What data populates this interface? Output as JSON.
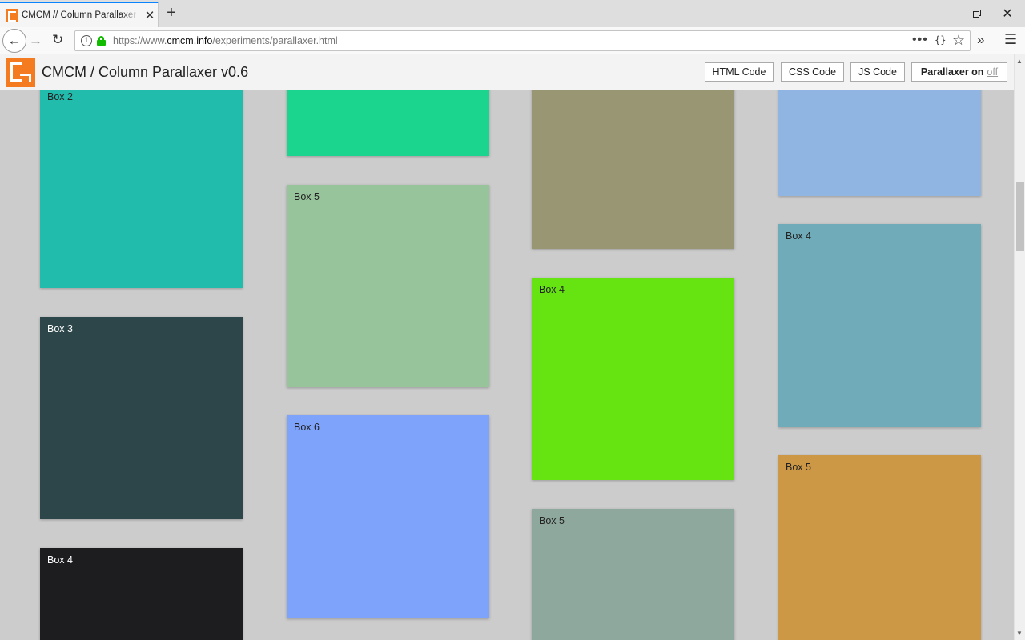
{
  "browser": {
    "tab_title": "CMCM // Column Parallaxer // CMCM",
    "url_prefix": "https://www.",
    "url_host": "cmcm.info",
    "url_path": "/experiments/parallaxer.html"
  },
  "header": {
    "title": "CMCM / Column Parallaxer v0.6",
    "buttons": {
      "html": "HTML Code",
      "css": "CSS Code",
      "js": "JS Code",
      "parallaxer": "Parallaxer on",
      "parallaxer_off": "off"
    }
  },
  "colors": {
    "accent_tab": "#0a84ff",
    "logo": "#f47b20",
    "page_bg": "#cccccc"
  },
  "columns": [
    {
      "boxes": [
        {
          "label": "Box 2",
          "color": "#22bcac",
          "text_color": "#222222"
        },
        {
          "label": "Box 3",
          "color": "#2d464a",
          "text_color": "#ffffff"
        },
        {
          "label": "Box 4",
          "color": "#1d1d20",
          "text_color": "#ffffff"
        }
      ]
    },
    {
      "boxes": [
        {
          "label": "",
          "color": "#1bd48d",
          "text_color": "#222222"
        },
        {
          "label": "Box 5",
          "color": "#98c49b",
          "text_color": "#222222"
        },
        {
          "label": "Box 6",
          "color": "#7ea3fb",
          "text_color": "#222222"
        }
      ]
    },
    {
      "boxes": [
        {
          "label": "",
          "color": "#999674",
          "text_color": "#222222"
        },
        {
          "label": "Box 4",
          "color": "#66e411",
          "text_color": "#222222"
        },
        {
          "label": "Box 5",
          "color": "#8ea89e",
          "text_color": "#222222"
        }
      ]
    },
    {
      "boxes": [
        {
          "label": "",
          "color": "#90b5e2",
          "text_color": "#222222"
        },
        {
          "label": "Box 4",
          "color": "#6fabb9",
          "text_color": "#222222"
        },
        {
          "label": "Box 5",
          "color": "#cc9845",
          "text_color": "#222222"
        }
      ]
    }
  ]
}
